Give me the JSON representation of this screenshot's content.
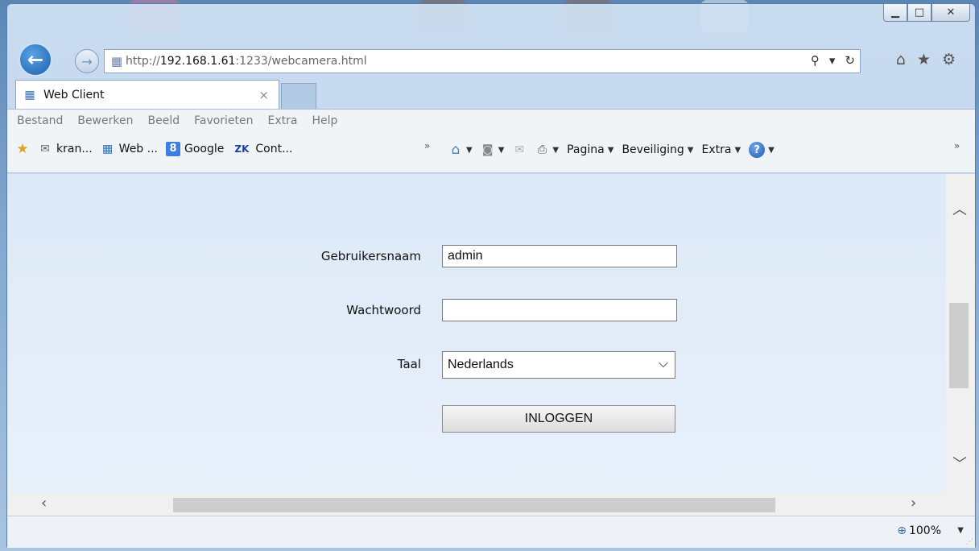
{
  "window": {
    "controls": {
      "minimize": "▁",
      "maximize": "□",
      "close": "✕"
    }
  },
  "address_bar": {
    "url_prefix": "http://",
    "url_host": "192.168.1.61",
    "url_rest": ":1233/webcamera.html",
    "search_icon": "⚲",
    "dropdown_icon": "▾",
    "refresh_icon": "↻"
  },
  "right_icons": {
    "home": "⌂",
    "favorites": "★",
    "tools": "⚙"
  },
  "tab": {
    "title": "Web Client",
    "close": "×"
  },
  "menu_bar": {
    "items": [
      "Bestand",
      "Bewerken",
      "Beeld",
      "Favorieten",
      "Extra",
      "Help"
    ]
  },
  "favorites_bar": {
    "items": [
      {
        "label": "kran...",
        "icon": "web-slice-icon"
      },
      {
        "label": "Web ...",
        "icon": "site-icon"
      },
      {
        "label": "Google",
        "icon": "google-icon"
      },
      {
        "label": "Cont...",
        "icon": "zk-icon"
      }
    ],
    "more": "»"
  },
  "command_bar": {
    "pagina": "Pagina",
    "beveiliging": "Beveiliging",
    "extra": "Extra",
    "more": "»"
  },
  "login_form": {
    "username_label": "Gebruikersnaam",
    "username_value": "admin",
    "password_label": "Wachtwoord",
    "password_value": "",
    "language_label": "Taal",
    "language_value": "Nederlands",
    "submit_label": "INLOGGEN"
  },
  "status_bar": {
    "zoom": "100%"
  }
}
